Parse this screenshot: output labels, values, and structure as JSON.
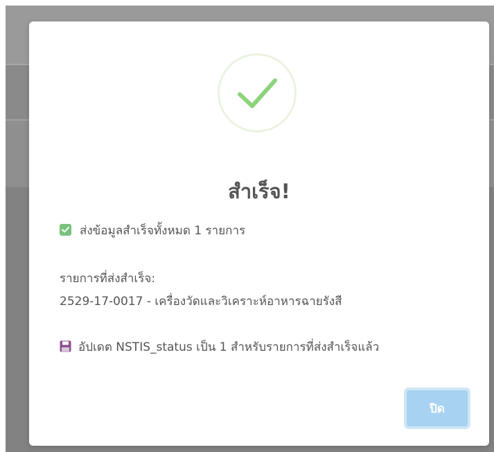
{
  "dialog": {
    "title": "สำเร็จ!",
    "summary": "ส่งข้อมูลสำเร็จทั้งหมด 1 รายการ",
    "items_heading": "รายการที่ส่งสำเร็จ:",
    "items": [
      "2529-17-0017 - เครื่องวัดและวิเคราะห์อาหารฉายรังสี"
    ],
    "update_note": "อัปเดต NSTIS_status เป็น 1 สำหรับรายการที่ส่งสำเร็จแล้ว",
    "close_label": "ปิด",
    "icons": {
      "success": "success-checkmark-icon",
      "summary": "checkbox-check-icon",
      "update": "floppy-disk-icon"
    },
    "colors": {
      "success_check": "#8cd47c",
      "summary_icon": "#79c27d",
      "update_icon": "#8e4f8e",
      "close_button": "#a7d2f1",
      "text": "#545454"
    }
  }
}
